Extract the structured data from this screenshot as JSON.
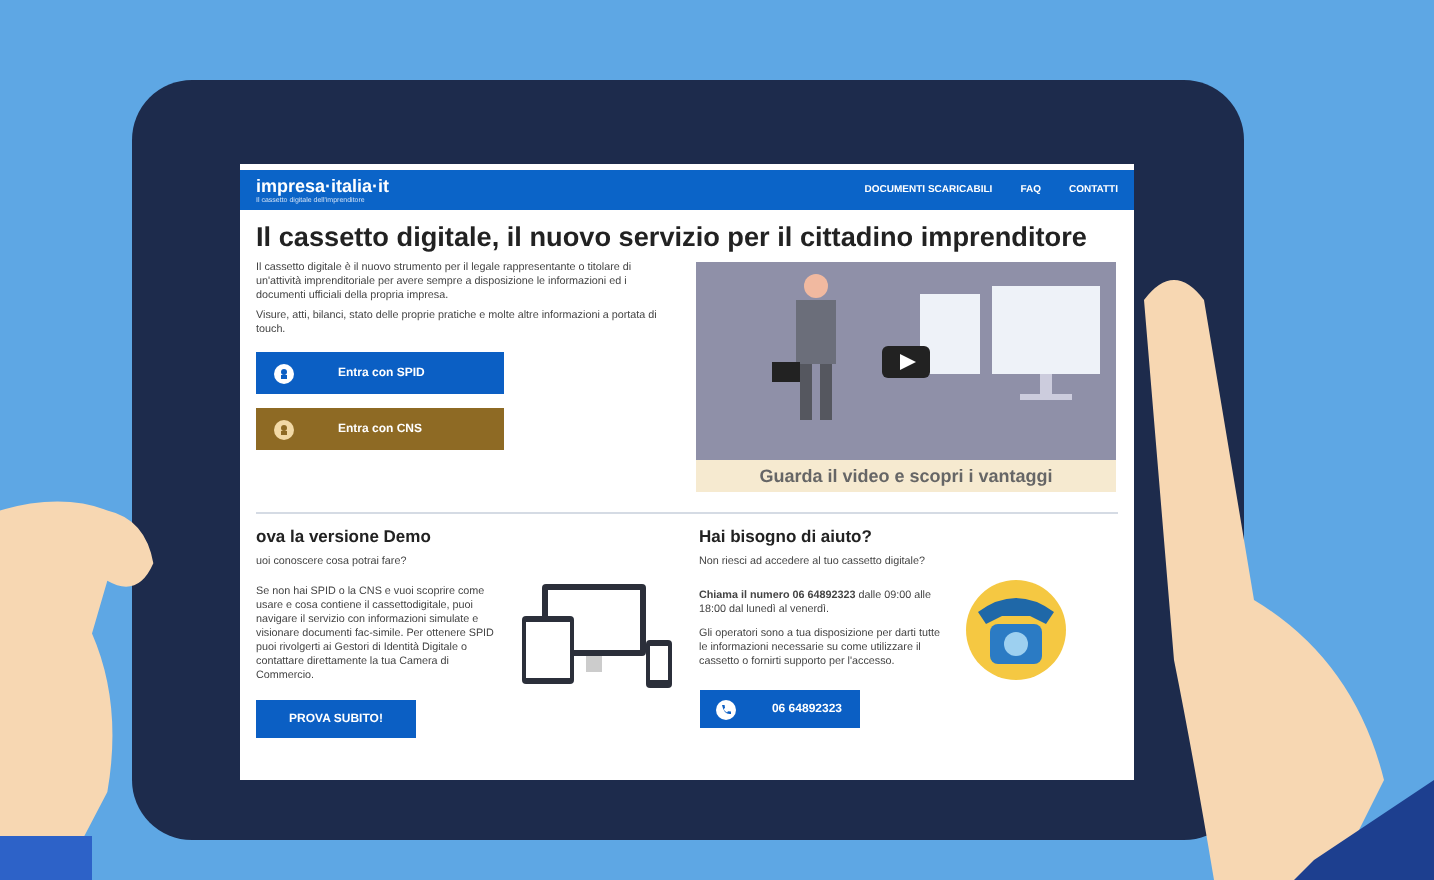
{
  "header": {
    "logo": "impresa·italia·it",
    "tagline": "Il cassetto digitale dell'imprenditore",
    "nav": [
      "DOCUMENTI SCARICABILI",
      "FAQ",
      "CONTATTI"
    ]
  },
  "title": "Il cassetto digitale, il nuovo servizio per il cittadino imprenditore",
  "intro": [
    "Il cassetto digitale è il nuovo strumento per il legale rappresentante o titolare di un'attività imprenditoriale per avere sempre a disposizione le informazioni ed i documenti ufficiali della propria impresa.",
    "Visure, atti, bilanci, stato delle proprie pratiche e molte altre informazioni a portata di touch."
  ],
  "login_buttons": [
    {
      "label": "Entra con SPID",
      "kind": "spid"
    },
    {
      "label": "Entra con CNS",
      "kind": "cns"
    }
  ],
  "video": {
    "caption": "Guarda il video e scopri i vantaggi"
  },
  "demo": {
    "heading": "ova la versione Demo",
    "question": "uoi conoscere cosa potrai fare?",
    "text": "Se non hai SPID o la CNS e vuoi scoprire come usare e cosa contiene il cassettodigitale, puoi navigare il servizio con informazioni simulate e visionare documenti fac-simile. Per ottenere SPID puoi rivolgerti ai Gestori di Identità Digitale o contattare direttamente la tua Camera di Commercio.",
    "button": "PROVA SUBITO!"
  },
  "help": {
    "heading": "Hai bisogno di aiuto?",
    "question": "Non riesci ad accedere al tuo cassetto digitale?",
    "call": "**Chiama il numero 06 64892323** dalle 09:00 alle 18:00 dal lunedì al venerdì.",
    "text": "Gli operatori sono a tua disposizione per darti tutte le informazioni necessarie su come utilizzare il cassetto o fornirti supporto per l'accesso.",
    "button": "06 64892323"
  }
}
